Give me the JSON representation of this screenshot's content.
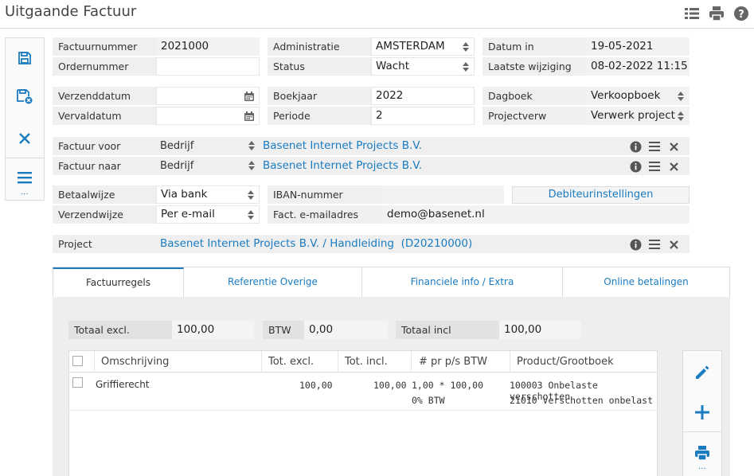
{
  "page": {
    "title": "Uitgaande Factuur"
  },
  "toolbar": {
    "icons": [
      "list-icon",
      "print-icon",
      "help-icon"
    ]
  },
  "sidebar": {
    "icons": [
      "save-icon",
      "save-close-icon",
      "close-icon",
      "menu-icon"
    ],
    "more": "..."
  },
  "fields": {
    "factuurnummer": {
      "label": "Factuurnummer",
      "value": "2021000"
    },
    "ordernummer": {
      "label": "Ordernummer",
      "value": ""
    },
    "administratie": {
      "label": "Administratie",
      "value": "AMSTERDAM"
    },
    "status": {
      "label": "Status",
      "value": "Wacht"
    },
    "datum_in": {
      "label": "Datum in",
      "value": "19-05-2021"
    },
    "laatste_wijziging": {
      "label": "Laatste wijziging",
      "value": "08-02-2022 11:15"
    },
    "verzenddatum": {
      "label": "Verzenddatum",
      "value": ""
    },
    "vervaldatum": {
      "label": "Vervaldatum",
      "value": ""
    },
    "boekjaar": {
      "label": "Boekjaar",
      "value": "2022"
    },
    "periode": {
      "label": "Periode",
      "value": "2"
    },
    "dagboek": {
      "label": "Dagboek",
      "value": "Verkoopboek"
    },
    "projectverw": {
      "label": "Projectverw",
      "value": "Verwerk project"
    },
    "factuur_voor": {
      "label": "Factuur voor",
      "type": "Bedrijf",
      "value": "Basenet Internet Projects B.V."
    },
    "factuur_naar": {
      "label": "Factuur naar",
      "type": "Bedrijf",
      "value": "Basenet Internet Projects B.V."
    },
    "betaalwijze": {
      "label": "Betaalwijze",
      "value": "Via bank"
    },
    "verzendwijze": {
      "label": "Verzendwijze",
      "value": "Per e-mail"
    },
    "iban": {
      "label": "IBAN-nummer",
      "value": ""
    },
    "fact_email": {
      "label": "Fact. e-mailadres",
      "value": "demo@basenet.nl"
    },
    "debiteur_button": "Debiteurinstellingen",
    "project": {
      "label": "Project",
      "value": "Basenet Internet Projects B.V. / Handleiding  (D20210000)"
    }
  },
  "tabs": [
    {
      "label": "Factuurregels",
      "active": true
    },
    {
      "label": "Referentie Overige",
      "active": false
    },
    {
      "label": "Financiele info / Extra",
      "active": false
    },
    {
      "label": "Online betalingen",
      "active": false
    }
  ],
  "totals": {
    "excl": {
      "label": "Totaal excl.",
      "value": "100,00"
    },
    "btw": {
      "label": "BTW",
      "value": "0,00"
    },
    "incl": {
      "label": "Totaal incl",
      "value": "100,00"
    }
  },
  "grid": {
    "headers": [
      "Omschrijving",
      "Tot. excl.",
      "Tot. incl.",
      "# pr p/s BTW",
      "Product/Grootboek"
    ],
    "rows": [
      {
        "omschrijving": "Griffierecht",
        "tot_excl": "100,00",
        "tot_incl": "100,00",
        "pr_line1": "1,00 * 100,00",
        "pr_line2": "0% BTW",
        "product_line1": "100003 Onbelaste verschotten",
        "product_line2": "21010 Verschotten onbelast"
      }
    ]
  },
  "right_bar": {
    "icons": [
      "edit-icon",
      "add-icon",
      "print-icon"
    ],
    "more": "..."
  }
}
